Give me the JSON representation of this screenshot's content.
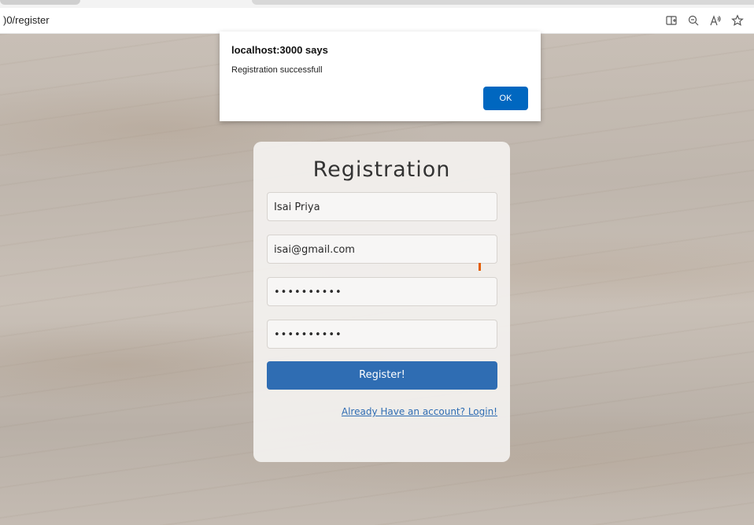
{
  "browser": {
    "url": ")0/register",
    "toolbar_icons": [
      "split-screen-icon",
      "zoom-out-icon",
      "read-aloud-icon",
      "favorite-star-icon"
    ]
  },
  "alert": {
    "title": "localhost:3000 says",
    "message": "Registration successfull",
    "ok_label": "OK"
  },
  "form": {
    "title": "Registration",
    "name_value": "Isai Priya",
    "email_value": "isai@gmail.com",
    "password_value": "••••••••••",
    "confirm_password_value": "••••••••••",
    "submit_label": "Register!",
    "login_link_label": "Already Have an account? Login!"
  },
  "colors": {
    "primary_button": "#2f6db3",
    "alert_button": "#0067c0",
    "link": "#2f6db3",
    "cursor_marker": "#e35d00"
  }
}
